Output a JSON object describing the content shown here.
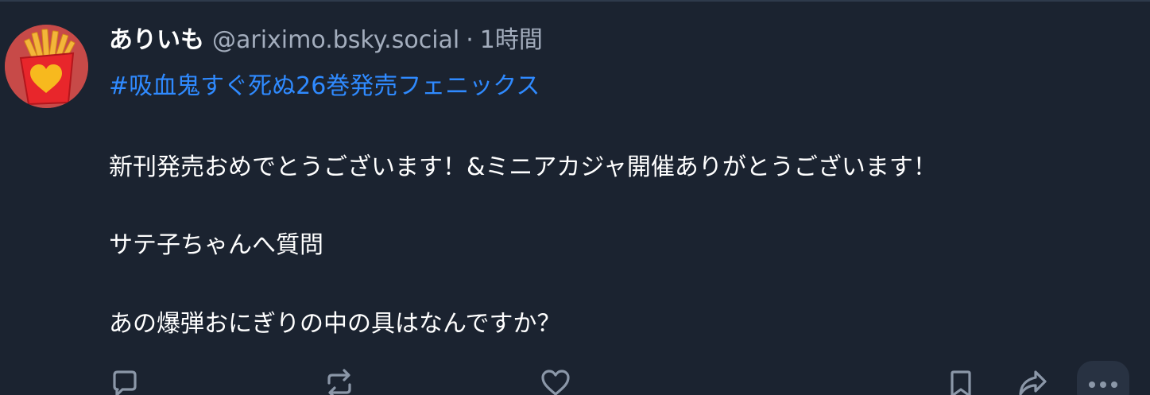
{
  "post": {
    "display_name": "ありいも",
    "handle": "@ariximo.bsky.social",
    "separator": "·",
    "time": "1時間",
    "hashtag": "#吸血鬼すぐ死ぬ26巻発売フェニックス",
    "lines": [
      "新刊発売おめでとうございます！&ミニアカジャ開催ありがとうございます！",
      "サテ子ちゃんへ質問",
      "あの爆弾おにぎりの中の具はなんですか？"
    ]
  },
  "icons": {
    "avatar": "french-fries-heart-avatar",
    "reply": "speech-bubble-icon",
    "repost": "repost-arrows-icon",
    "like": "heart-icon",
    "bookmark": "bookmark-icon",
    "share": "share-arrow-icon",
    "more": "ellipsis-icon"
  },
  "colors": {
    "background": "#1b2330",
    "text": "#ffffff",
    "muted": "#a3adbd",
    "link": "#2f8aff",
    "icon": "#8b97a8",
    "avatar_bg": "#c74a48"
  }
}
